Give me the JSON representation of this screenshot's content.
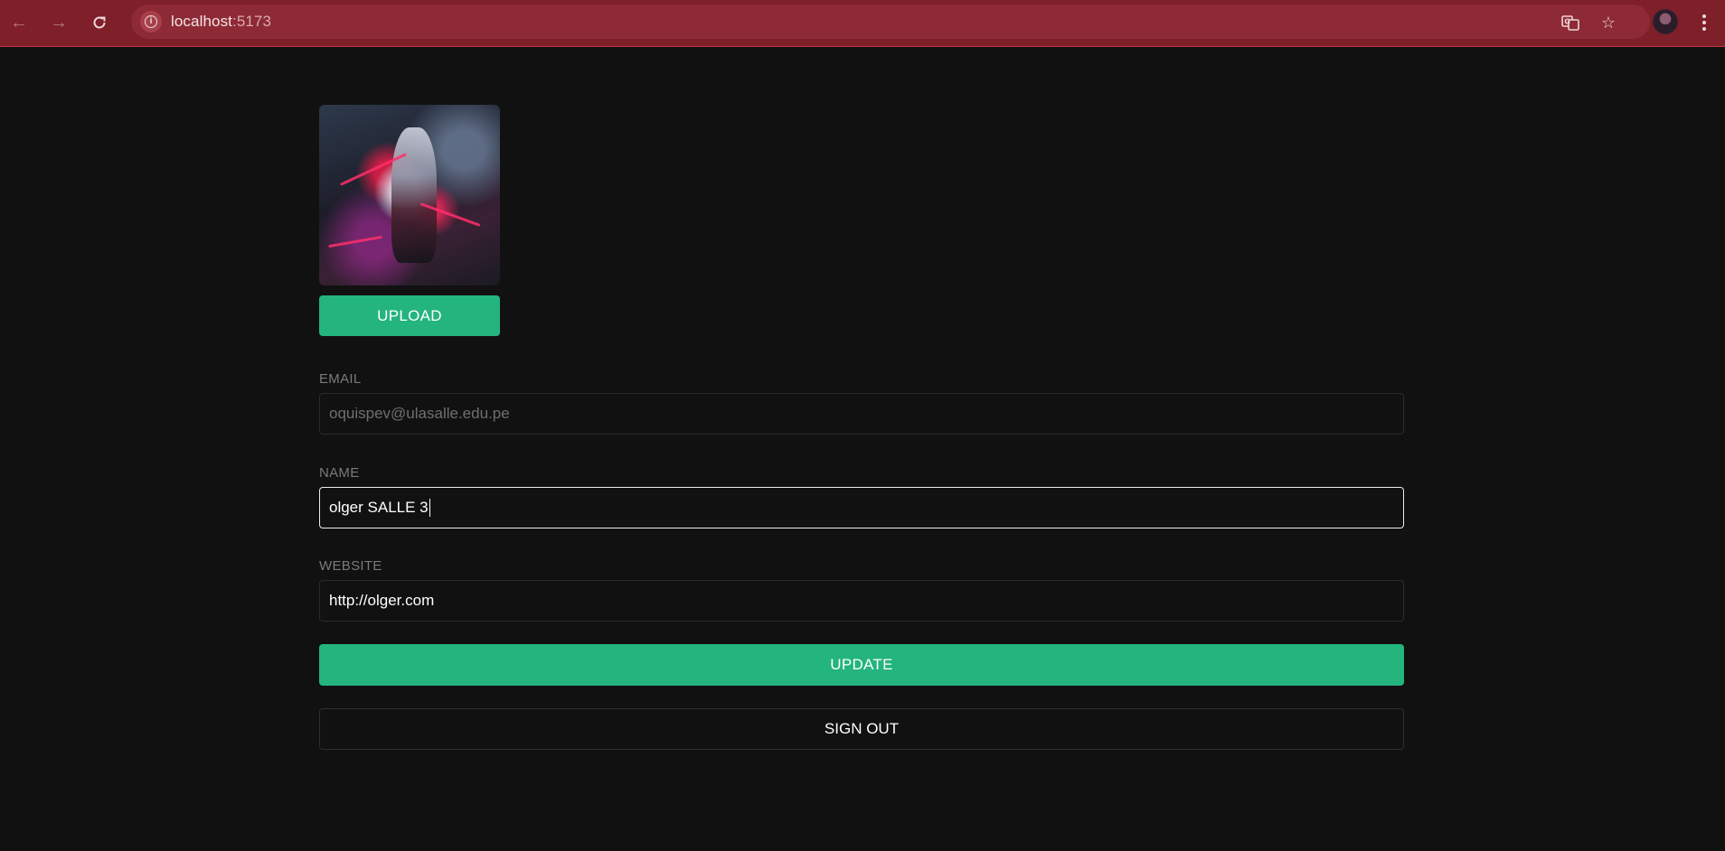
{
  "browser": {
    "url_host": "localhost",
    "url_port": ":5173",
    "back_icon": "arrow-left-icon",
    "forward_icon": "arrow-right-icon",
    "reload_icon": "reload-icon",
    "info_icon": "info-icon",
    "translate_icon": "translate-icon",
    "bookmark_icon": "star-icon",
    "menu_icon": "kebab-menu-icon",
    "theme_color": "#7e1f2a"
  },
  "profile": {
    "upload_label": "UPLOAD",
    "email": {
      "label": "EMAIL",
      "value": "oquispev@ulasalle.edu.pe"
    },
    "name": {
      "label": "NAME",
      "value": "olger SALLE 3"
    },
    "website": {
      "label": "WEBSITE",
      "value": "http://olger.com"
    },
    "update_label": "UPDATE",
    "signout_label": "SIGN OUT",
    "accent_color": "#24b47e"
  }
}
